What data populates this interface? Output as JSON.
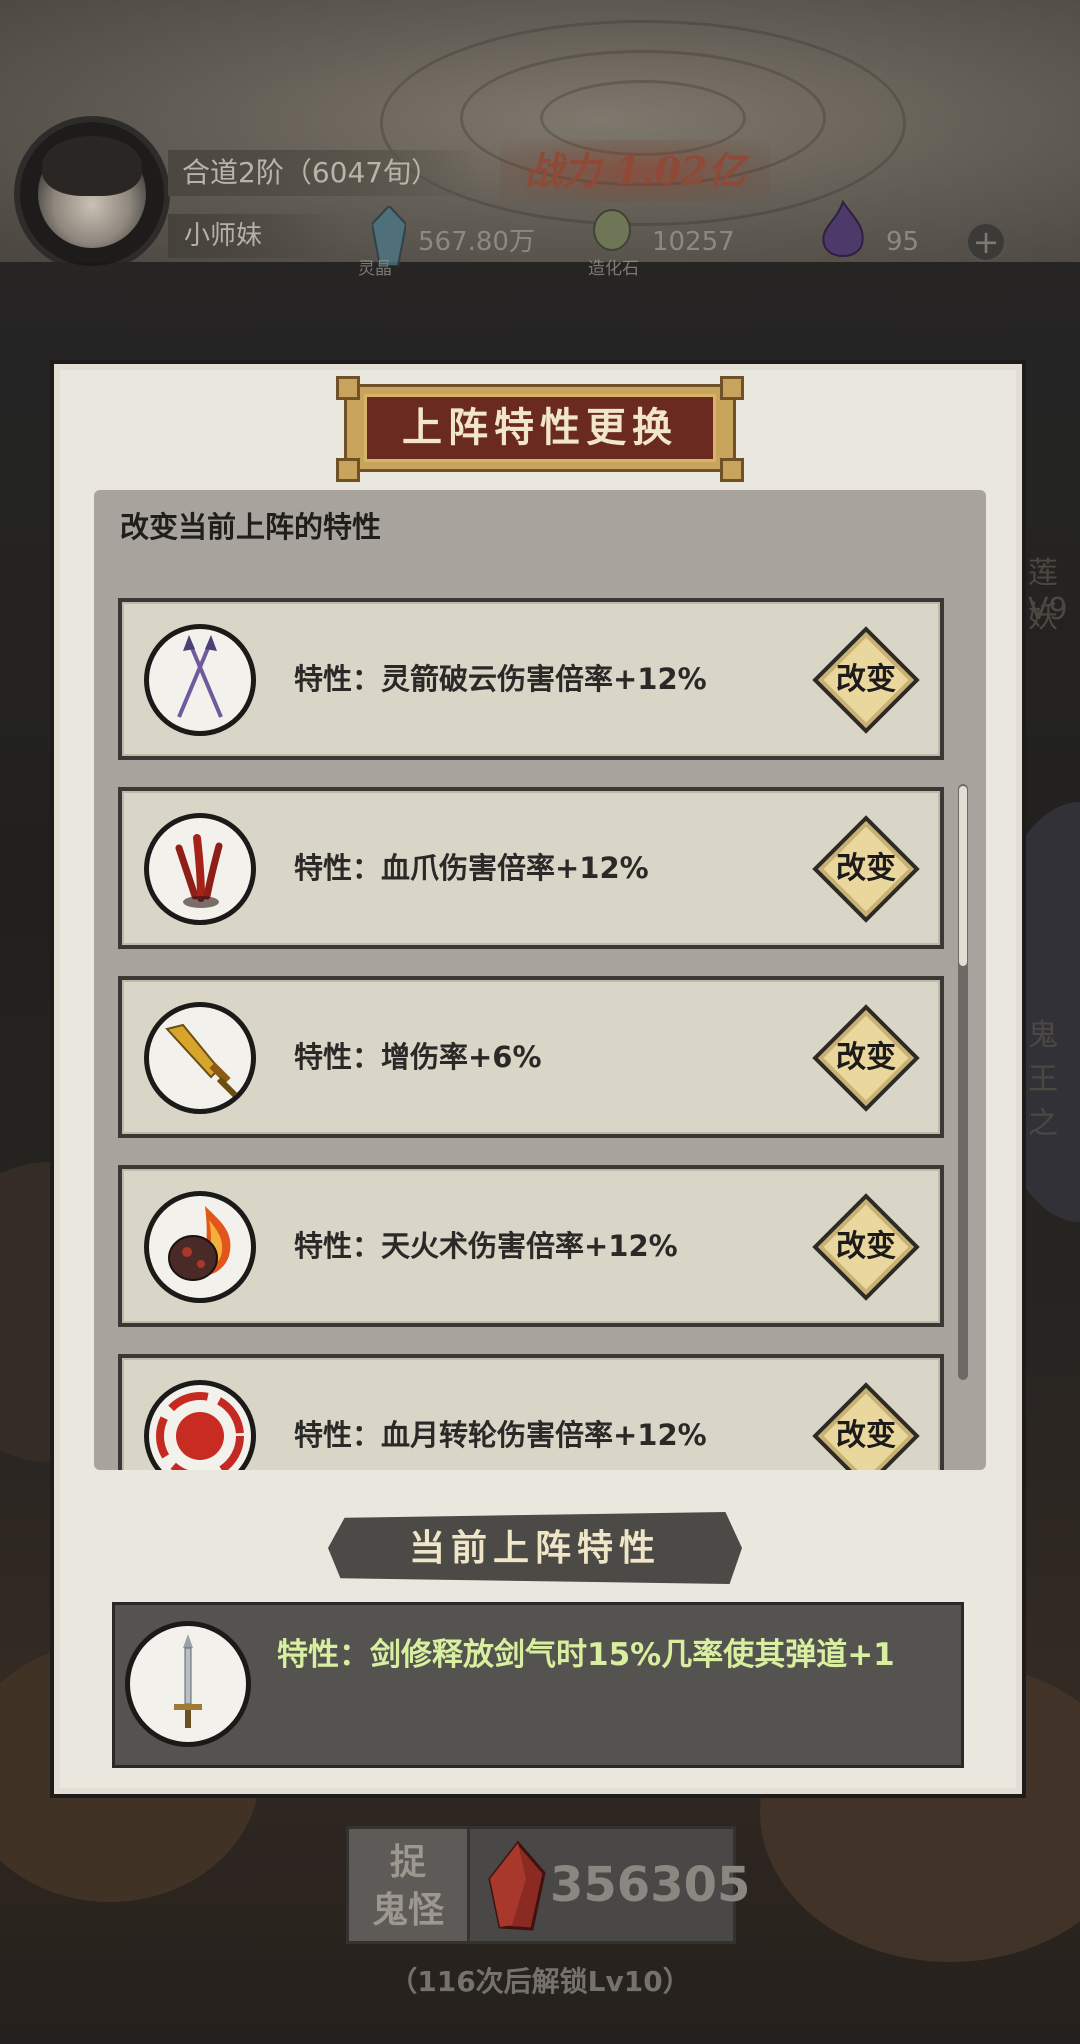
{
  "header": {
    "realm": "合道2阶（6047旬）",
    "player_name": "小师妹",
    "power_label": "战力",
    "power_value": "1.02亿",
    "resources": [
      {
        "name": "灵晶",
        "value": "567.80万",
        "icon": "blue-crystal-icon"
      },
      {
        "name": "造化石",
        "value": "10257",
        "icon": "green-stone-icon"
      },
      {
        "name": "",
        "value": "95",
        "icon": "purple-flame-icon"
      }
    ],
    "plus_label": "+"
  },
  "modal": {
    "title": "上阵特性更换",
    "description": "改变当前上阵的特性",
    "traits": [
      {
        "text": "特性：灵箭破云伤害倍率+12%",
        "icon": "crossed-arrows-icon",
        "button": "改变"
      },
      {
        "text": "特性：血爪伤害倍率+12%",
        "icon": "blood-claw-icon",
        "button": "改变"
      },
      {
        "text": "特性：增伤率+6%",
        "icon": "golden-sword-icon",
        "button": "改变"
      },
      {
        "text": "特性：天火术伤害倍率+12%",
        "icon": "fire-meteor-icon",
        "button": "改变"
      },
      {
        "text": "特性：血月转轮伤害倍率+12%",
        "icon": "blood-moon-icon",
        "button": "改变"
      }
    ],
    "current_title": "当前上阵特性",
    "current_trait": {
      "text": "特性：剑修释放剑气时15%几率使其弹道+1",
      "icon": "flying-sword-icon"
    }
  },
  "capture": {
    "label_line1": "捉",
    "label_line2": "鬼怪",
    "count": "356305",
    "icon": "red-crystal-icon",
    "unlock_note": "（116次后解锁Lv10）"
  },
  "side_peek": {
    "top": "莲妖",
    "level": "V9",
    "bottom": "鬼王之"
  },
  "colors": {
    "modal_bg": "#eae7de",
    "card_bg": "#d9d6c8",
    "button_gold": "#e9d79d",
    "title_red": "#6b2a1f",
    "current_text_green": "#d8efa0"
  }
}
